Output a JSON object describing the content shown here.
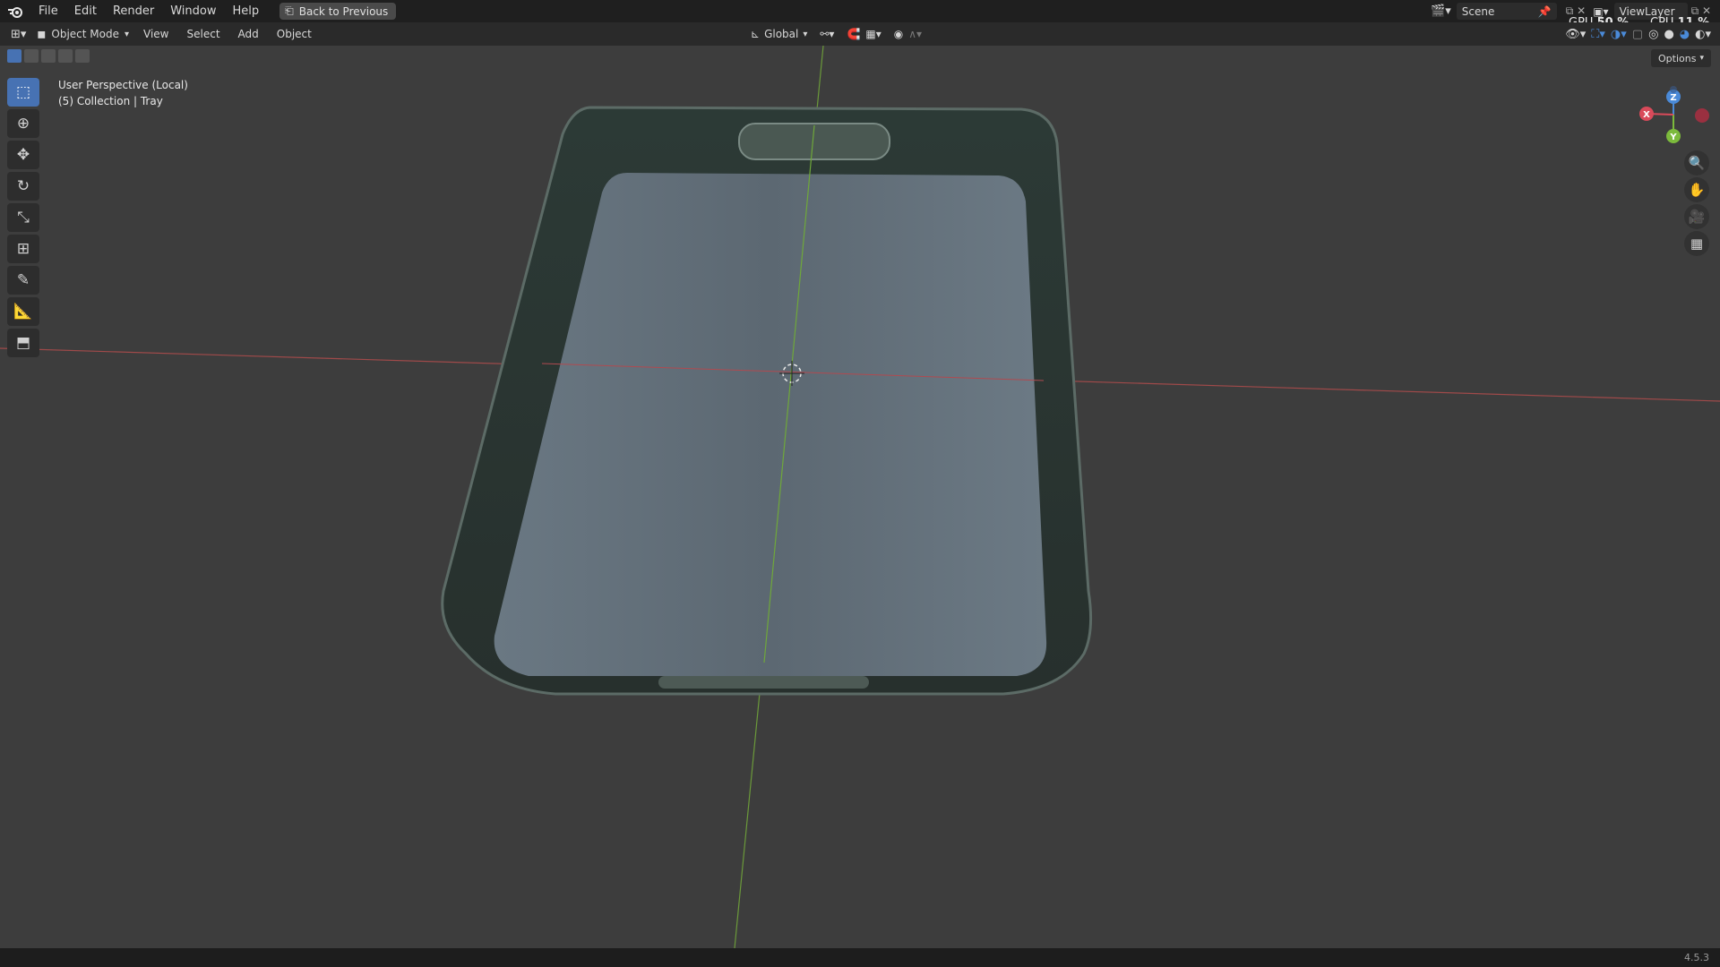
{
  "menubar": {
    "items": [
      "File",
      "Edit",
      "Render",
      "Window",
      "Help"
    ],
    "back_button": "Back to Previous"
  },
  "scene": {
    "name": "Scene"
  },
  "view_layer": {
    "name": "ViewLayer"
  },
  "stats": {
    "gpu_label": "GPU",
    "gpu_value": "50 %",
    "cpu_label": "CPU",
    "cpu_value": "11 %"
  },
  "header": {
    "mode": "Object Mode",
    "menus": [
      "View",
      "Select",
      "Add",
      "Object"
    ],
    "orientation": "Global"
  },
  "viewport": {
    "perspective": "User Perspective (Local)",
    "collection": "(5) Collection | Tray",
    "options": "Options"
  },
  "gizmo": {
    "x": "X",
    "y": "Y",
    "z": "Z"
  },
  "status": {
    "version": "4.5.3"
  },
  "colors": {
    "accent": "#4772b3",
    "x_axis": "#d94a5a",
    "y_axis": "#7cba3c",
    "z_axis": "#4a8ad8"
  }
}
